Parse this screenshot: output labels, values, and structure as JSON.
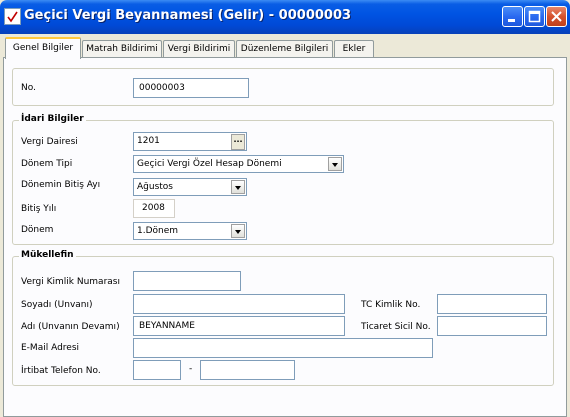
{
  "window": {
    "title": "Geçici Vergi Beyannamesi (Gelir) - 00000003",
    "icon": "document-check-icon",
    "buttons": [
      "minimize-icon",
      "maximize-icon",
      "close-icon"
    ]
  },
  "tabs": [
    {
      "label": "Genel Bilgiler",
      "active": true
    },
    {
      "label": "Matrah Bildirimi",
      "active": false
    },
    {
      "label": "Vergi Bildirimi",
      "active": false
    },
    {
      "label": "Düzenleme Bilgileri",
      "active": false
    },
    {
      "label": "Ekler",
      "active": false
    }
  ],
  "general": {
    "no_label": "No.",
    "no_value": "00000003"
  },
  "idari": {
    "title": "İdari Bilgiler",
    "vergi_dairesi_label": "Vergi Dairesi",
    "vergi_dairesi_value": "1201",
    "ellipsis": "...",
    "donem_tipi_label": "Dönem Tipi",
    "donem_tipi_value": "Geçici Vergi Özel Hesap Dönemi",
    "donemin_bitis_ayi_label": "Dönemin Bitiş Ayı",
    "donemin_bitis_ayi_value": "Ağustos",
    "bitis_yili_label": "Bitiş Yılı",
    "bitis_yili_value": "2008",
    "donem_label": "Dönem",
    "donem_value": "1.Dönem"
  },
  "mukellef": {
    "title": "Mükellefin",
    "vkn_label": "Vergi Kimlik Numarası",
    "vkn_value": "",
    "soyadi_label": "Soyadı (Unvanı)",
    "soyadi_value": "",
    "tc_label": "TC Kimlik No.",
    "tc_value": "",
    "adi_label": "Adı (Unvanın Devamı)",
    "adi_value": "BEYANNAME",
    "ticaret_label": "Ticaret Sicil No.",
    "ticaret_value": "",
    "email_label": "E-Mail Adresi",
    "email_value": "",
    "telefon_label": "İrtibat Telefon No.",
    "telefon_area": "",
    "telefon_sep": "-",
    "telefon_number": ""
  },
  "colors": {
    "titlebar": "#0054E3",
    "tab_highlight": "#FFC83C",
    "panel": "#FCFCFE",
    "window_bg": "#ECE9D8"
  }
}
